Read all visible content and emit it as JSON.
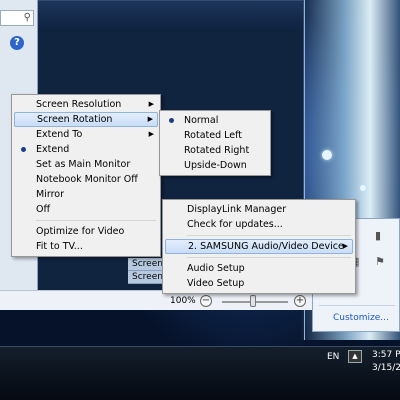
{
  "explorer": {
    "search_icon": "search-icon",
    "help_icon_text": "?"
  },
  "main_menu": {
    "items": [
      {
        "label": "Screen Resolution",
        "submenu": true
      },
      {
        "label": "Screen Rotation",
        "submenu": true,
        "highlighted": true
      },
      {
        "label": "Extend To",
        "submenu": true
      },
      {
        "label": "Extend",
        "checked": true
      },
      {
        "label": "Set as Main Monitor"
      },
      {
        "label": "Notebook Monitor Off"
      },
      {
        "label": "Mirror"
      },
      {
        "label": "Off"
      },
      {
        "separator": true
      },
      {
        "label": "Optimize for Video"
      },
      {
        "label": "Fit to TV..."
      }
    ]
  },
  "rotation_menu": {
    "items": [
      {
        "label": "Normal",
        "checked": true
      },
      {
        "label": "Rotated Left"
      },
      {
        "label": "Rotated Right"
      },
      {
        "label": "Upside-Down"
      }
    ]
  },
  "displaylink_menu": {
    "items": [
      {
        "label": "DisplayLink Manager"
      },
      {
        "label": "Check for updates..."
      },
      {
        "separator": true
      },
      {
        "label": "2. SAMSUNG Audio/Video Device",
        "submenu": true,
        "highlighted": true
      },
      {
        "separator": true
      },
      {
        "label": "Audio Setup"
      },
      {
        "label": "Video Setup"
      }
    ]
  },
  "screen_labels": [
    "Screen",
    "Screen"
  ],
  "statusbar": {
    "zoom": "100%",
    "minus": "−",
    "plus": "+"
  },
  "tray": {
    "customize": "Customize..."
  },
  "taskbar": {
    "language": "EN",
    "time": "3:57 P",
    "date": "3/15/20"
  },
  "colors": {
    "highlight": "#c9ddf7",
    "menu_bg": "#f0f0f0",
    "link": "#1b58c5"
  }
}
